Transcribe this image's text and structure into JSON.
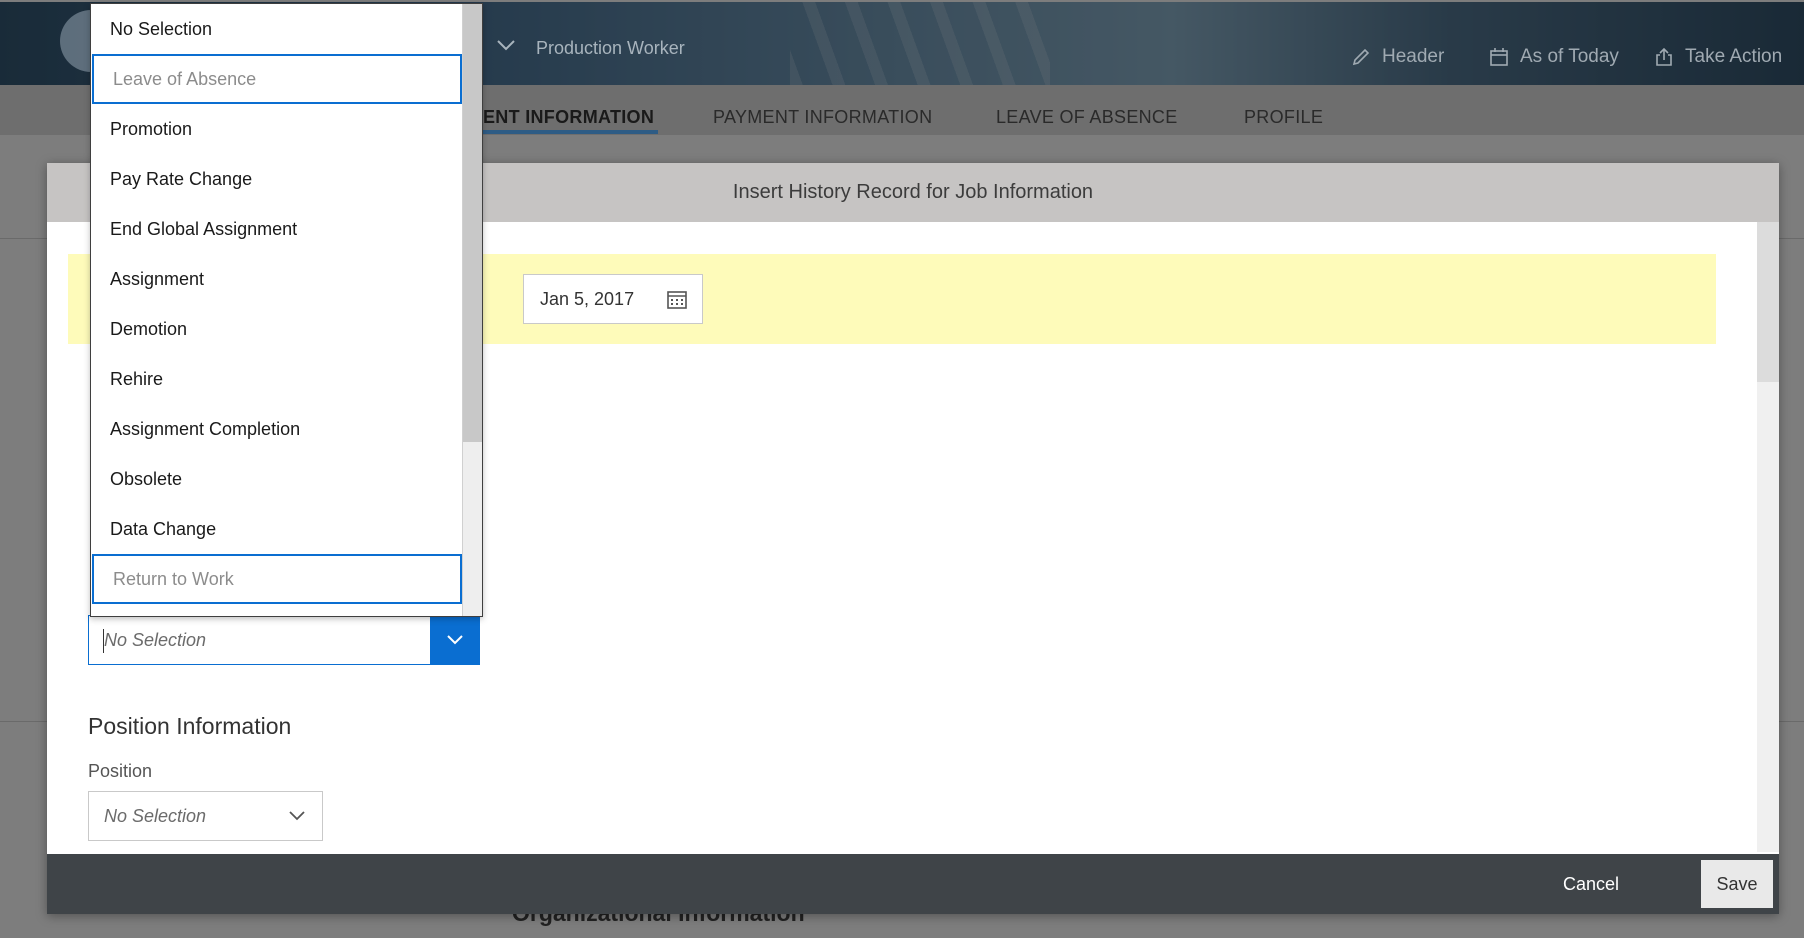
{
  "header": {
    "worker_title": "Production Worker",
    "actions": [
      {
        "label": "Header",
        "icon": "pencil-icon"
      },
      {
        "label": "As of Today",
        "icon": "calendar-icon"
      },
      {
        "label": "Take Action",
        "icon": "share-icon"
      }
    ]
  },
  "tabs": [
    {
      "label": "ENT INFORMATION",
      "active": true
    },
    {
      "label": "PAYMENT INFORMATION",
      "active": false
    },
    {
      "label": "LEAVE OF ABSENCE",
      "active": false
    },
    {
      "label": "PROFILE",
      "active": false
    }
  ],
  "background": {
    "org_info": "Organizational Information"
  },
  "dialog": {
    "title": "Insert History Record for Job Information",
    "effective_date": "Jan 5, 2017",
    "event_reason": {
      "placeholder": "No Selection"
    },
    "position_section": {
      "title": "Position Information",
      "position_label": "Position",
      "position_value": "No Selection"
    },
    "footer": {
      "cancel": "Cancel",
      "save": "Save"
    }
  },
  "dropdown": {
    "items": [
      {
        "label": "No Selection",
        "enabled": true
      },
      {
        "label": "Leave of Absence",
        "enabled": false
      },
      {
        "label": "Promotion",
        "enabled": true
      },
      {
        "label": "Pay Rate Change",
        "enabled": true
      },
      {
        "label": "End Global Assignment",
        "enabled": true
      },
      {
        "label": "Assignment",
        "enabled": true
      },
      {
        "label": "Demotion",
        "enabled": true
      },
      {
        "label": "Rehire",
        "enabled": true
      },
      {
        "label": "Assignment Completion",
        "enabled": true
      },
      {
        "label": "Obsolete",
        "enabled": true
      },
      {
        "label": "Data Change",
        "enabled": true
      },
      {
        "label": "Return to Work",
        "enabled": false
      }
    ]
  },
  "colors": {
    "accent": "#0a6ed1",
    "highlight_row": "#fefbba",
    "footer": "#3f4448"
  }
}
